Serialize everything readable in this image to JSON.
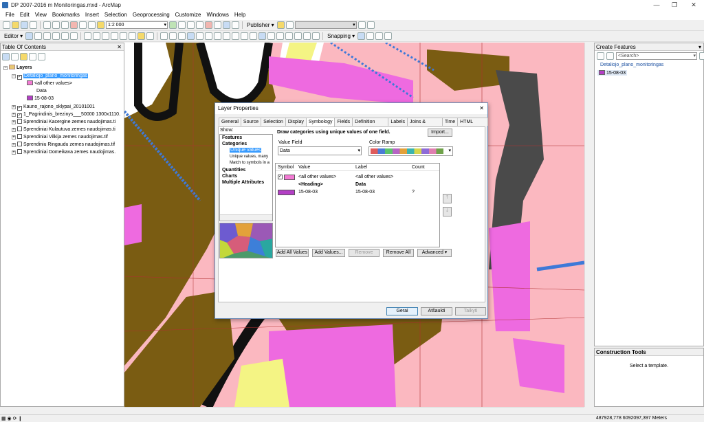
{
  "window": {
    "title": "DP 2007-2016 m Monitoringas.mxd - ArcMap",
    "minimize": "—",
    "maximize": "❐",
    "close": "✕"
  },
  "menu": [
    "File",
    "Edit",
    "View",
    "Bookmarks",
    "Insert",
    "Selection",
    "Geoprocessing",
    "Customize",
    "Windows",
    "Help"
  ],
  "toolbar": {
    "scale": "1:2 000",
    "publisher": "Publisher ▾",
    "editor": "Editor ▾",
    "snapping": "Snapping ▾"
  },
  "toc": {
    "title": "Table Of Contents",
    "close": "✕",
    "layers_root": "Layers",
    "layer1": "Detaliojo_plano_monitoringas",
    "legend_other": "<all other values>",
    "legend_heading": "Data",
    "legend_value": "15-08-03",
    "others": [
      "Kauno_rajono_sklypai_20101001",
      "1_Pagrindinis_brezinys___50000 1300x1110.",
      "Sprendiniai Kacergine zemes naudojimas.ti",
      "Sprendiniai Kulautuva zemes naudojimas.ti",
      "Sprendiniai Vilkija zemes naudojimas.tif",
      "Sprendiniu Ringaudu zemes naudojimas.tif",
      "Sprendiniai Domeikava zemes naudojimas."
    ]
  },
  "create": {
    "title": "Create Features",
    "search_placeholder": "<Search>",
    "layer": "Detaliojo_plano_monitoringas",
    "template": "15-08-03"
  },
  "construction": {
    "title": "Construction Tools",
    "hint": "Select a template."
  },
  "dialog": {
    "title": "Layer Properties",
    "close": "✕",
    "tabs": [
      "General",
      "Source",
      "Selection",
      "Display",
      "Symbology",
      "Fields",
      "Definition Query",
      "Labels",
      "Joins & Relates",
      "Time",
      "HTML Popup"
    ],
    "show_label": "Show:",
    "show_items": [
      "Features",
      "Categories",
      "Unique values",
      "Unique values, many",
      "Match to symbols in a",
      "Quantities",
      "Charts",
      "Multiple Attributes"
    ],
    "heading": "Draw categories using unique values of one field.",
    "import": "Import...",
    "value_field_label": "Value Field",
    "value_field": "Data",
    "color_ramp_label": "Color Ramp",
    "columns": [
      "Symbol",
      "Value",
      "Label",
      "Count"
    ],
    "rows": [
      {
        "value": "<all other values>",
        "label": "<all other values>",
        "count": ""
      },
      {
        "value": "<Heading>",
        "label": "Data",
        "count": ""
      },
      {
        "value": "15-08-03",
        "label": "15-08-03",
        "count": "?"
      }
    ],
    "buttons": {
      "add_all": "Add All Values",
      "add": "Add Values...",
      "remove": "Remove",
      "remove_all": "Remove All",
      "advanced": "Advanced ▾",
      "ok": "Gerai",
      "cancel": "Atšaukti",
      "apply": "Taikyti"
    }
  },
  "status": {
    "coords": "487928,778  6092097,397 Meters"
  },
  "colors": {
    "pink": "#fbb8c0",
    "magenta": "#ee6ae0",
    "olive": "#7a5c12",
    "symbol_pink": "#f27ad3",
    "symbol_purple": "#b33fc5",
    "selection": "#3399ff"
  }
}
